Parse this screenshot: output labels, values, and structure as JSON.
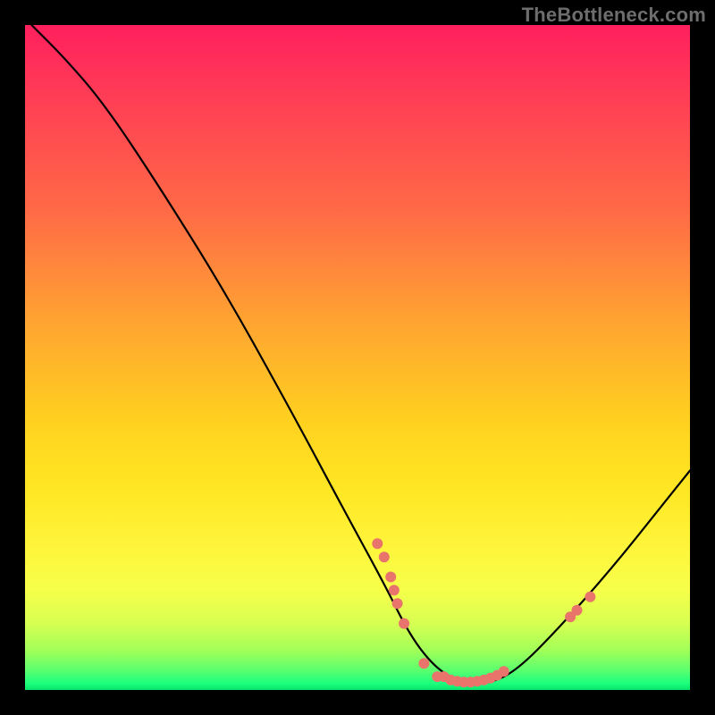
{
  "watermark": "TheBottleneck.com",
  "chart_data": {
    "type": "line",
    "title": "",
    "xlabel": "",
    "ylabel": "",
    "xlim": [
      0,
      100
    ],
    "ylim": [
      0,
      100
    ],
    "grid": false,
    "curve": {
      "name": "bottleneck-curve",
      "color": "#000000",
      "points": [
        {
          "x": 1,
          "y": 100
        },
        {
          "x": 6,
          "y": 95
        },
        {
          "x": 12,
          "y": 88
        },
        {
          "x": 20,
          "y": 76
        },
        {
          "x": 30,
          "y": 60
        },
        {
          "x": 40,
          "y": 42
        },
        {
          "x": 48,
          "y": 27
        },
        {
          "x": 54,
          "y": 16
        },
        {
          "x": 58,
          "y": 8
        },
        {
          "x": 62,
          "y": 3
        },
        {
          "x": 66,
          "y": 1
        },
        {
          "x": 70,
          "y": 1
        },
        {
          "x": 74,
          "y": 3
        },
        {
          "x": 80,
          "y": 9
        },
        {
          "x": 88,
          "y": 18
        },
        {
          "x": 96,
          "y": 28
        },
        {
          "x": 100,
          "y": 33
        }
      ]
    },
    "markers": {
      "name": "highlight-dots",
      "color": "#e8746b",
      "radius_px": 6,
      "points": [
        {
          "x": 53,
          "y": 22
        },
        {
          "x": 54,
          "y": 20
        },
        {
          "x": 55,
          "y": 17
        },
        {
          "x": 55.5,
          "y": 15
        },
        {
          "x": 56,
          "y": 13
        },
        {
          "x": 57,
          "y": 10
        },
        {
          "x": 60,
          "y": 4
        },
        {
          "x": 62,
          "y": 2
        },
        {
          "x": 63,
          "y": 2
        },
        {
          "x": 64,
          "y": 1.5
        },
        {
          "x": 65,
          "y": 1.3
        },
        {
          "x": 66,
          "y": 1.2
        },
        {
          "x": 67,
          "y": 1.2
        },
        {
          "x": 68,
          "y": 1.3
        },
        {
          "x": 69,
          "y": 1.5
        },
        {
          "x": 70,
          "y": 1.8
        },
        {
          "x": 71,
          "y": 2.2
        },
        {
          "x": 72,
          "y": 2.8
        },
        {
          "x": 82,
          "y": 11
        },
        {
          "x": 83,
          "y": 12
        },
        {
          "x": 85,
          "y": 14
        }
      ]
    }
  }
}
